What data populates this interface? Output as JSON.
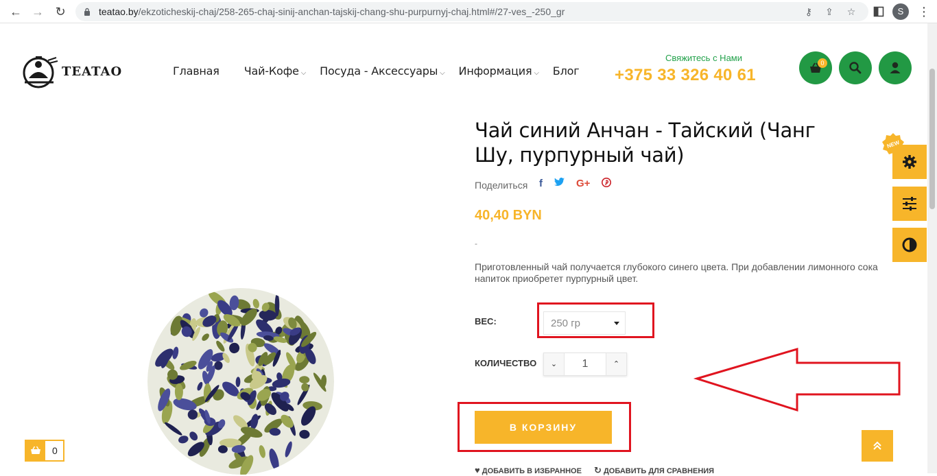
{
  "browser": {
    "url_host": "teatao.by",
    "url_path": "/ekzoticheskij-chaj/258-265-chaj-sinij-anchan-tajskij-chang-shu-purpurnyj-chaj.html#/27-ves_-250_gr",
    "profile_initial": "S"
  },
  "header": {
    "logo_text": "TEATAO",
    "nav": [
      {
        "label": "Главная",
        "has_dropdown": false
      },
      {
        "label": "Чай-Кофе",
        "has_dropdown": true
      },
      {
        "label": "Посуда - Аксессуары",
        "has_dropdown": true
      },
      {
        "label": "Информация",
        "has_dropdown": true
      },
      {
        "label": "Блог",
        "has_dropdown": false
      }
    ],
    "contact_label": "Свяжитесь с Нами",
    "phone": "+375 33 326 40 61",
    "cart_count": "0"
  },
  "product": {
    "title": "Чай синий Анчан - Тайский (Чанг Шу, пурпурный чай)",
    "share_label": "Поделиться",
    "price": "40,40 BYN",
    "short_dash": "-",
    "description": "Приготовленный чай получается глубокого синего цвета. При добавлении лимонного сока напиток приобретет пурпурный цвет.",
    "weight_label": "ВЕС:",
    "weight_value": "250 гр",
    "qty_label": "КОЛИЧЕСТВО",
    "qty_value": "1",
    "add_to_cart": "В КОРЗИНУ",
    "wishlist": "ДОБАВИТЬ В ИЗБРАННОЕ",
    "compare": "ДОБАВИТЬ ДЛЯ СРАВНЕНИЯ"
  },
  "widgets": {
    "new_badge": "NEW",
    "floating_cart_count": "0"
  },
  "colors": {
    "accent": "#f7b52a",
    "green": "#229944",
    "annotation_red": "#e0141f"
  }
}
